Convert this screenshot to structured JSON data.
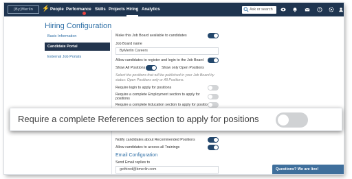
{
  "nav": {
    "logo": "[By]Merlin",
    "items": [
      "People",
      "Performance",
      "Skills",
      "Projects",
      "Hiring",
      "Analytics"
    ],
    "active": "Hiring",
    "search_placeholder": "Ask or search"
  },
  "page": {
    "title": "Hiring Configuration"
  },
  "sidebar": {
    "items": [
      "Basic Information",
      "Candidate Portal",
      "External Job Portals"
    ],
    "active_index": 1
  },
  "settings": {
    "make_available": {
      "label": "Make this Job Board available to candidates",
      "on": true
    },
    "board_name": {
      "label": "Job Board name",
      "value": "ByMerlin Careers"
    },
    "allow_register": {
      "label": "Allow candidates to register and login to the Job Board",
      "on": true
    },
    "show_all": {
      "label": "Show All Positions",
      "on": true
    },
    "show_open": {
      "label": "Show only Open Positions"
    },
    "note": "Select the positions that will be published in your Job Board by status: Open Positions only or All Positions.",
    "require_login": {
      "label": "Require login to apply for positions",
      "on": false
    },
    "require_employment": {
      "label": "Require a complete Employment section to apply for positions",
      "on": false
    },
    "require_education": {
      "label": "Require a complete Education section to apply for positions",
      "on": false
    },
    "notify_recommended": {
      "label": "Notify candidates about Recommended Positions",
      "on": true
    },
    "allow_trainings": {
      "label": "Allow candidates to access all Trainings",
      "on": true
    }
  },
  "email": {
    "section_title": "Email Configuration",
    "reply_label": "Send Email replies to",
    "reply_value": "gethired@bmerlin.com"
  },
  "callout": {
    "label": "Require a complete References section to apply for positions",
    "on": false
  },
  "chat": {
    "label": "Questions? We are live!"
  },
  "colors": {
    "nav_bg": "#1f3550",
    "accent": "#2d6ea5",
    "toggle_on": "#23476c",
    "toggle_off": "#d2d4d6"
  }
}
